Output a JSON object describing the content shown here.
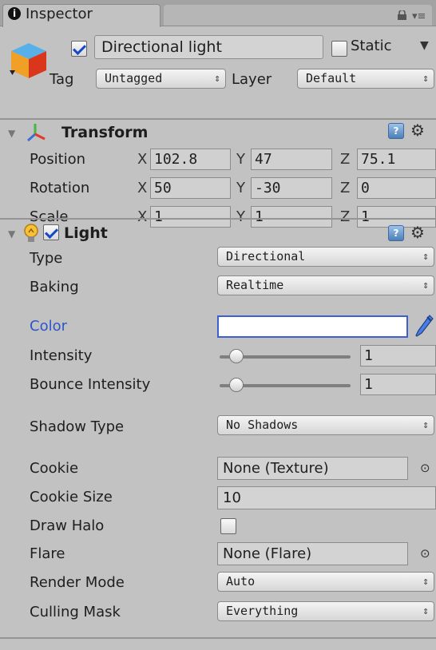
{
  "tab": {
    "title": "Inspector",
    "info_icon": "i"
  },
  "gameobject": {
    "name": "Directional light",
    "active": true,
    "static_label": "Static",
    "static": false,
    "tag_label": "Tag",
    "tag_value": "Untagged",
    "layer_label": "Layer",
    "layer_value": "Default"
  },
  "transform": {
    "title": "Transform",
    "rows": [
      {
        "label": "Position",
        "x": "102.8",
        "y": "47",
        "z": "75.1"
      },
      {
        "label": "Rotation",
        "x": "50",
        "y": "-30",
        "z": "0"
      },
      {
        "label": "Scale",
        "x": "1",
        "y": "1",
        "z": "1"
      }
    ],
    "axis": {
      "x": "X",
      "y": "Y",
      "z": "Z"
    }
  },
  "light": {
    "title": "Light",
    "enabled": true,
    "type_label": "Type",
    "type_value": "Directional",
    "baking_label": "Baking",
    "baking_value": "Realtime",
    "color_label": "Color",
    "color_value": "#ffffff",
    "intensity_label": "Intensity",
    "intensity_value": "1",
    "bounce_label": "Bounce Intensity",
    "bounce_value": "1",
    "slider_fraction": 0.125,
    "shadow_label": "Shadow Type",
    "shadow_value": "No Shadows",
    "cookie_label": "Cookie",
    "cookie_value": "None (Texture)",
    "cookie_size_label": "Cookie Size",
    "cookie_size_value": "10",
    "draw_halo_label": "Draw Halo",
    "draw_halo": false,
    "flare_label": "Flare",
    "flare_value": "None (Flare)",
    "render_mode_label": "Render Mode",
    "render_mode_value": "Auto",
    "culling_label": "Culling Mask",
    "culling_value": "Everything"
  },
  "colors": {
    "accent_label": "#2b57c8",
    "color_field_border": "#3e5fd0"
  }
}
